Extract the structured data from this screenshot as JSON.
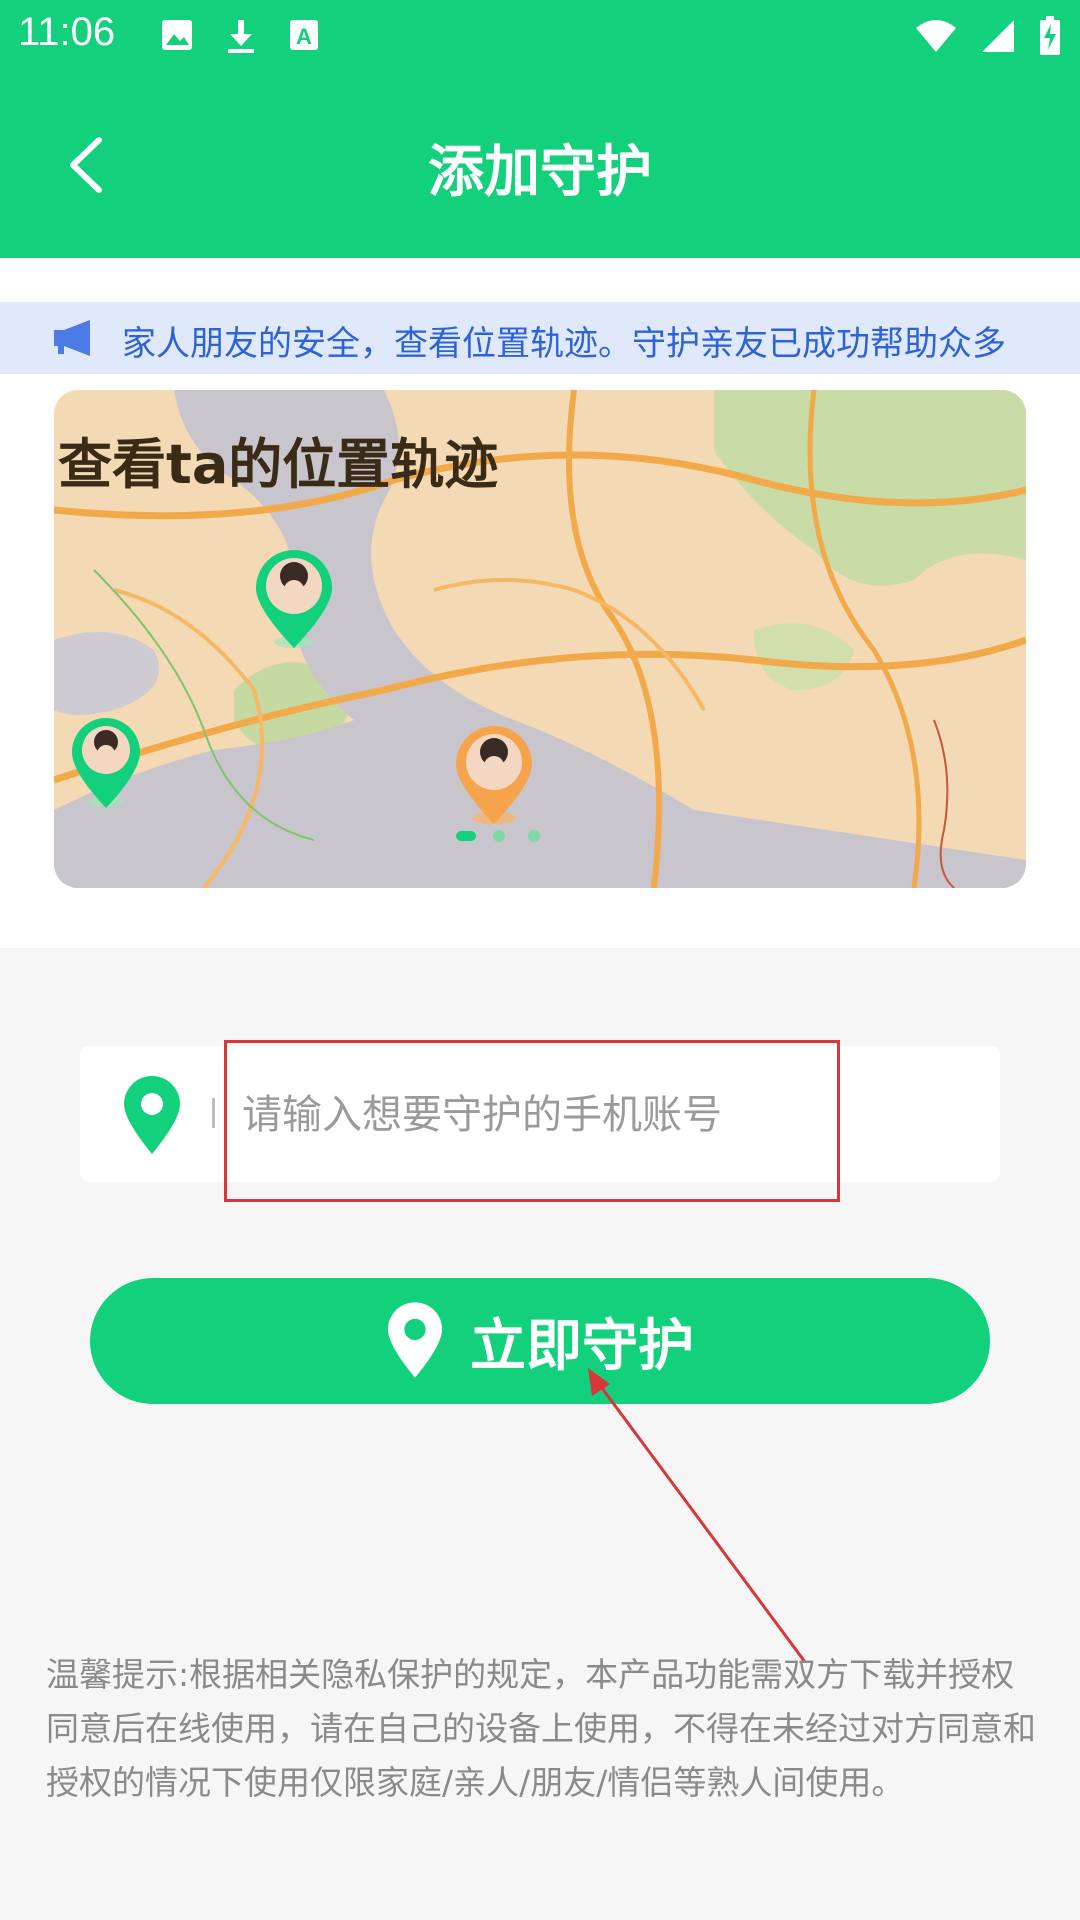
{
  "statusbar": {
    "time": "11:06"
  },
  "header": {
    "title": "添加守护"
  },
  "notice": {
    "text": "家人朋友的安全，查看位置轨迹。守护亲友已成功帮助众多"
  },
  "banner": {
    "title": "查看ta的位置轨迹"
  },
  "form": {
    "phone_placeholder": "请输入想要守护的手机账号",
    "phone_value": ""
  },
  "actions": {
    "guard_label": "立即守护"
  },
  "tip": {
    "text": "温馨提示:根据相关隐私保护的规定，本产品功能需双方下载并授权同意后在线使用，请在自己的设备上使用，不得在未经过对方同意和授权的情况下使用仅限家庭/亲人/朋友/情侣等熟人间使用。"
  },
  "colors": {
    "primary": "#12d07b",
    "notice_bg": "#dfe9fb",
    "notice_text": "#2e62d8",
    "annotation": "#d8363a"
  }
}
